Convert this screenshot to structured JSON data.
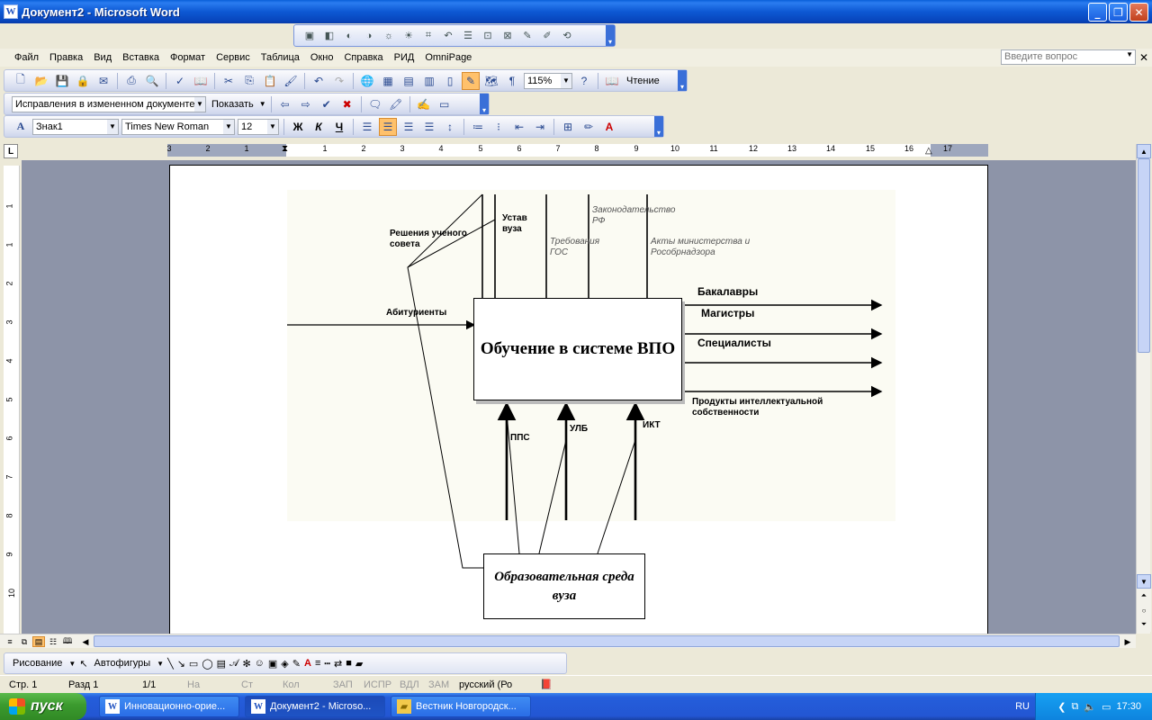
{
  "window": {
    "title": "Документ2 - Microsoft Word",
    "app_icon": "W"
  },
  "menu": [
    "Файл",
    "Правка",
    "Вид",
    "Вставка",
    "Формат",
    "Сервис",
    "Таблица",
    "Окно",
    "Справка",
    "РИД",
    "OmniPage"
  ],
  "ask_placeholder": "Введите вопрос",
  "toolbar_standard": {
    "zoom": "115%",
    "reading": "Чтение"
  },
  "toolbar_review": {
    "track_mode": "Исправления в измененном документе",
    "show": "Показать"
  },
  "toolbar_format": {
    "style": "Знак1",
    "font": "Times New Roman",
    "size": "12",
    "bold": "Ж",
    "italic": "К",
    "underline": "Ч"
  },
  "ruler": {
    "ticks": [
      "3",
      "2",
      "1",
      "1",
      "2",
      "3",
      "4",
      "5",
      "6",
      "7",
      "8",
      "9",
      "10",
      "11",
      "12",
      "13",
      "14",
      "15",
      "16",
      "17"
    ],
    "corner": "L"
  },
  "vruler": {
    "ticks": [
      "1",
      "1",
      "2",
      "3",
      "4",
      "5",
      "6",
      "7",
      "8",
      "9",
      "10",
      "11"
    ]
  },
  "diagram": {
    "main_box": "Обучение в системе ВПО",
    "env_box": "Образовательная среда вуза",
    "controls": [
      "Решения ученого совета",
      "Устав вуза",
      "Требования ГОС",
      "Законодательство РФ",
      "Акты министерства и Рособрнадзора"
    ],
    "input": "Абитуриенты",
    "outputs": [
      "Бакалавры",
      "Магистры",
      "Специалисты",
      "Продукты интеллектуальной собственности"
    ],
    "mechanisms": [
      "ППС",
      "УЛБ",
      "ИКТ"
    ]
  },
  "drawing_toolbar": {
    "drawing": "Рисование",
    "autoshapes": "Автофигуры"
  },
  "status": {
    "page": "Стр. 1",
    "section": "Разд 1",
    "pages": "1/1",
    "at": "На",
    "line": "Ст",
    "col": "Кол",
    "rec": "ЗАП",
    "trk": "ИСПР",
    "ext": "ВДЛ",
    "ovr": "ЗАМ",
    "language": "русский (Ро"
  },
  "taskbar": {
    "start": "пуск",
    "tasks": [
      "Инновационно-орие...",
      "Документ2 - Microso...",
      "Вестник Новгородск..."
    ],
    "lang": "RU",
    "clock": "17:30"
  }
}
